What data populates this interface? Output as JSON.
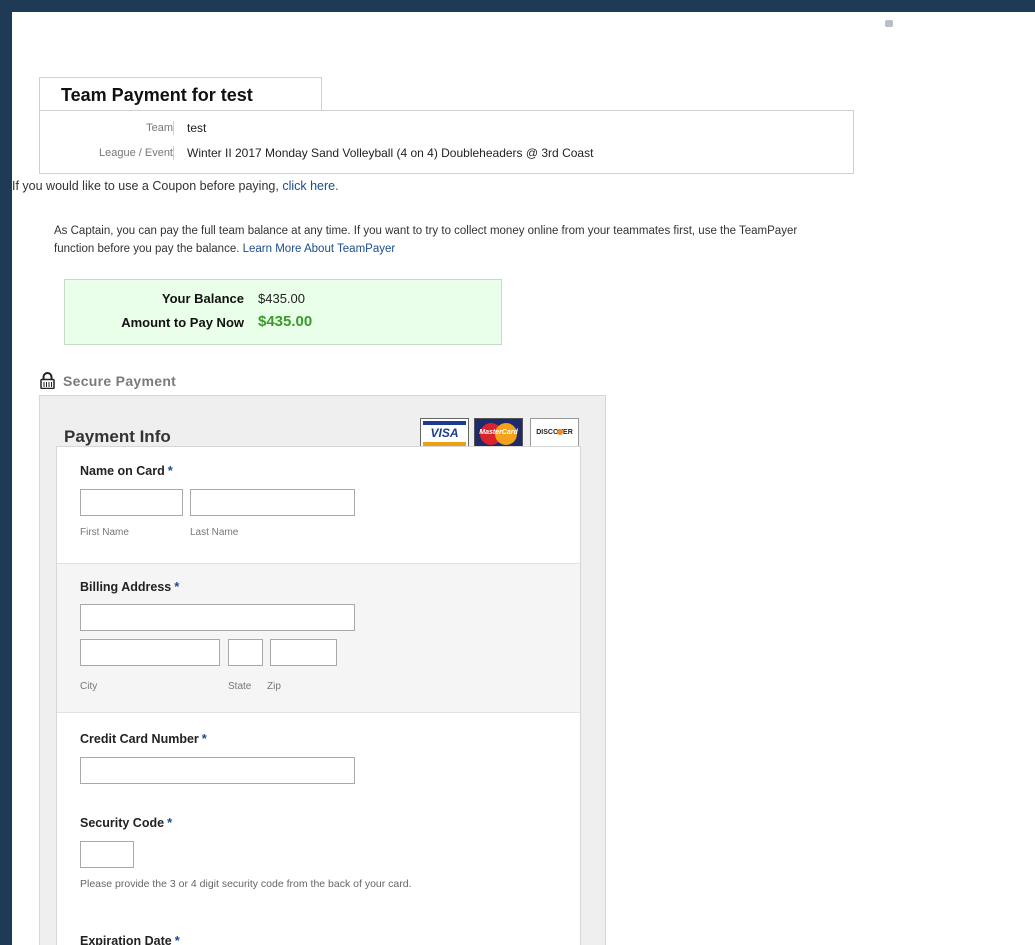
{
  "team_payment": {
    "title": "Team Payment for test",
    "team_label": "Team",
    "team_value": "test",
    "event_label": "League / Event",
    "event_value": "Winter II 2017 Monday Sand Volleyball (4 on 4) Doubleheaders @ 3rd Coast"
  },
  "coupon": {
    "text": "If you would like to use a Coupon before paying,",
    "link": "click here."
  },
  "captain": {
    "text": "As Captain, you can pay the full team balance at any time. If you want to try to collect money online from your teammates first, use the TeamPayer function before you pay the balance.",
    "link": "Learn More About TeamPayer"
  },
  "balance": {
    "your_balance_label": "Your Balance",
    "your_balance_value": "$435.00",
    "pay_now_label": "Amount to Pay Now",
    "pay_now_value": "$435.00"
  },
  "secure": {
    "label": "Secure Payment",
    "icon": "lock-icon"
  },
  "payment": {
    "title": "Payment Info",
    "cards": [
      "VISA",
      "MasterCard",
      "DISCOVER"
    ],
    "name_label": "Name on Card",
    "first_name_hint": "First Name",
    "last_name_hint": "Last Name",
    "billing_label": "Billing Address",
    "city_hint": "City",
    "state_hint": "State",
    "zip_hint": "Zip",
    "cc_label": "Credit Card Number",
    "security_label": "Security Code",
    "security_note": "Please provide the 3 or 4 digit security code from the back of your card.",
    "expiration_label": "Expiration Date",
    "required_mark": "*"
  },
  "colors": {
    "link": "#1a4d8f",
    "amount_green": "#3a9a2a",
    "balance_bg": "#eaffea",
    "page_bg": "#1f3a55"
  }
}
